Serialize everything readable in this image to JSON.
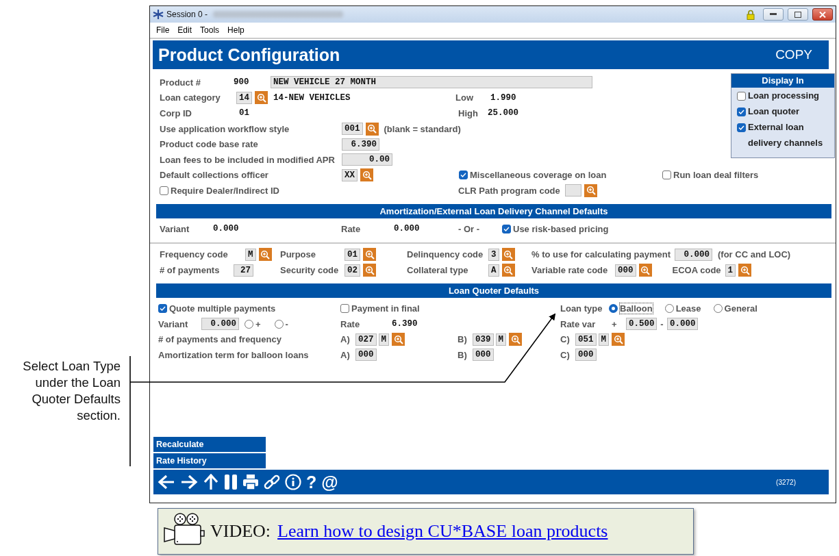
{
  "window": {
    "title": "Session 0 -",
    "menu": [
      "File",
      "Edit",
      "Tools",
      "Help"
    ]
  },
  "header": {
    "title": "Product Configuration",
    "mode": "COPY"
  },
  "product": {
    "label": "Product #",
    "number": "900",
    "description": "NEW VEHICLE 27 MONTH"
  },
  "loan_category": {
    "label": "Loan category",
    "code": "14",
    "name": "14-NEW VEHICLES"
  },
  "low": {
    "label": "Low",
    "value": "1.990"
  },
  "corp_id": {
    "label": "Corp ID",
    "value": "01"
  },
  "high": {
    "label": "High",
    "value": "25.000"
  },
  "workflow_style": {
    "label": "Use application workflow style",
    "value": "001",
    "hint": "(blank = standard)"
  },
  "base_rate": {
    "label": "Product code base rate",
    "value": "6.390"
  },
  "loan_fees": {
    "label": "Loan fees to be included in modified APR",
    "value": "0.00"
  },
  "collections_officer": {
    "label": "Default collections officer",
    "value": "XX"
  },
  "misc_coverage": {
    "label": "Miscellaneous coverage on loan",
    "checked": true
  },
  "run_filters": {
    "label": "Run loan deal filters",
    "checked": false
  },
  "require_dealer": {
    "label": "Require Dealer/Indirect ID",
    "checked": false
  },
  "clr_path": {
    "label": "CLR Path program code"
  },
  "display_in": {
    "title": "Display In",
    "options": [
      {
        "label": "Loan processing",
        "checked": false
      },
      {
        "label": "Loan quoter",
        "checked": true
      },
      {
        "label": "External loan delivery channels",
        "checked": true
      }
    ]
  },
  "amortization": {
    "title": "Amortization/External Loan Delivery Channel Defaults",
    "variant_label": "Variant",
    "variant": "0.000",
    "rate_label": "Rate",
    "rate": "0.000",
    "or": "- Or -",
    "risk_based": {
      "label": "Use risk-based pricing",
      "checked": true
    }
  },
  "codes": {
    "frequency": {
      "label": "Frequency code",
      "value": "M"
    },
    "purpose": {
      "label": "Purpose",
      "value": "01"
    },
    "delinquency": {
      "label": "Delinquency code",
      "value": "3"
    },
    "pct_payment": {
      "label": "% to use for calculating payment",
      "value": "0.000",
      "note": "(for CC and LOC)"
    },
    "payments": {
      "label": "# of payments",
      "value": "27"
    },
    "security": {
      "label": "Security code",
      "value": "02"
    },
    "collateral": {
      "label": "Collateral type",
      "value": "A"
    },
    "variable_rate": {
      "label": "Variable rate code",
      "value": "000"
    },
    "ecoa": {
      "label": "ECOA code",
      "value": "1"
    }
  },
  "quoter": {
    "title": "Loan Quoter Defaults",
    "quote_multiple": {
      "label": "Quote multiple payments",
      "checked": true
    },
    "payment_in_final": {
      "label": "Payment in final",
      "checked": false
    },
    "loan_type": {
      "label": "Loan type",
      "options": [
        {
          "label": "Balloon",
          "selected": true
        },
        {
          "label": "Lease",
          "selected": false
        },
        {
          "label": "General",
          "selected": false
        }
      ]
    },
    "variant": {
      "label": "Variant",
      "value": "0.000",
      "signs": [
        {
          "label": "+",
          "selected": false
        },
        {
          "label": "-",
          "selected": false
        }
      ]
    },
    "rate": {
      "label": "Rate",
      "value": "6.390"
    },
    "rate_var": {
      "label": "Rate var",
      "plus": "+",
      "plus_value": "0.500",
      "minus": "-",
      "minus_value": "0.000"
    },
    "payments_frequency": {
      "label": "# of payments and frequency",
      "terms": [
        {
          "letter": "A)",
          "count": "027",
          "frequency": "M"
        },
        {
          "letter": "B)",
          "count": "039",
          "frequency": "M"
        },
        {
          "letter": "C)",
          "count": "051",
          "frequency": "M"
        }
      ]
    },
    "amortization_term": {
      "label": "Amortization term for balloon loans",
      "terms": [
        {
          "letter": "A)",
          "count": "000"
        },
        {
          "letter": "B)",
          "count": "000"
        },
        {
          "letter": "C)",
          "count": "000"
        }
      ]
    }
  },
  "side_buttons": [
    "Recalculate",
    "Rate History"
  ],
  "toolbar": {
    "glyphs": [
      "?",
      "@"
    ],
    "code": "(3272)"
  },
  "annotation": "Select Loan Type under the Loan Quoter Defaults section.",
  "video": {
    "label": "VIDEO:",
    "link": "Learn how to design CU*BASE loan products"
  }
}
